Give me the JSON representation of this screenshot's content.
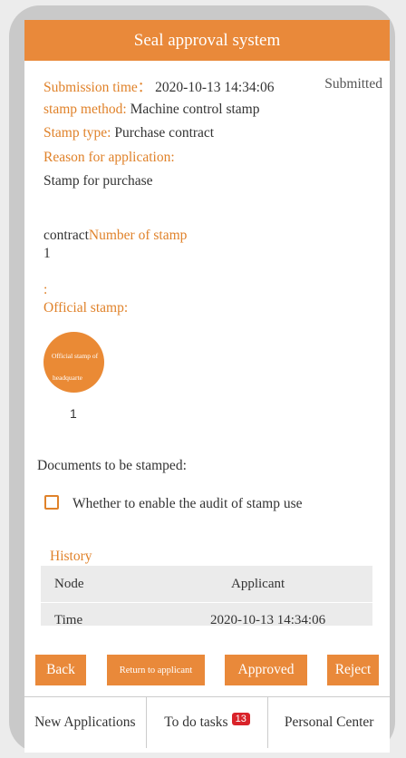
{
  "header": {
    "title": "Seal approval system"
  },
  "details": {
    "submission_time_label": "Submission time：",
    "submission_time_value": "2020-10-13 14:34:06",
    "status": "Submitted",
    "stamp_method_label": "stamp method:",
    "stamp_method_value": "Machine control stamp",
    "stamp_type_label": "Stamp type:",
    "stamp_type_value": "Purchase contract",
    "reason_label": "Reason for application:",
    "reason_value": "Stamp for purchase",
    "contract_prefix": "contract",
    "number_label": "Number of stamp",
    "number_value": "1",
    "colon": ":",
    "official_stamp_label": "Official stamp:"
  },
  "stamp": {
    "line1": "Official stamp of",
    "line2": "headquarte",
    "count": "1",
    "color": "#ea8a35"
  },
  "documents_label": "Documents to be stamped:",
  "audit_checkbox": {
    "label": "Whether to enable the audit of stamp use",
    "checked": false
  },
  "history": {
    "title": "History",
    "rows": [
      {
        "key": "Node",
        "value": "Applicant"
      },
      {
        "key": "Time",
        "value": "2020-10-13 14:34:06"
      }
    ]
  },
  "actions": {
    "back": "Back",
    "return_to_applicant": "Return to applicant",
    "approved": "Approved",
    "reject": "Reject"
  },
  "tabbar": {
    "new_applications": "New Applications",
    "todo_tasks": "To do tasks",
    "todo_count": "13",
    "personal_center": "Personal Center"
  },
  "colors": {
    "accent": "#e9893a",
    "label": "#e0822a",
    "badge": "#d9232a"
  }
}
